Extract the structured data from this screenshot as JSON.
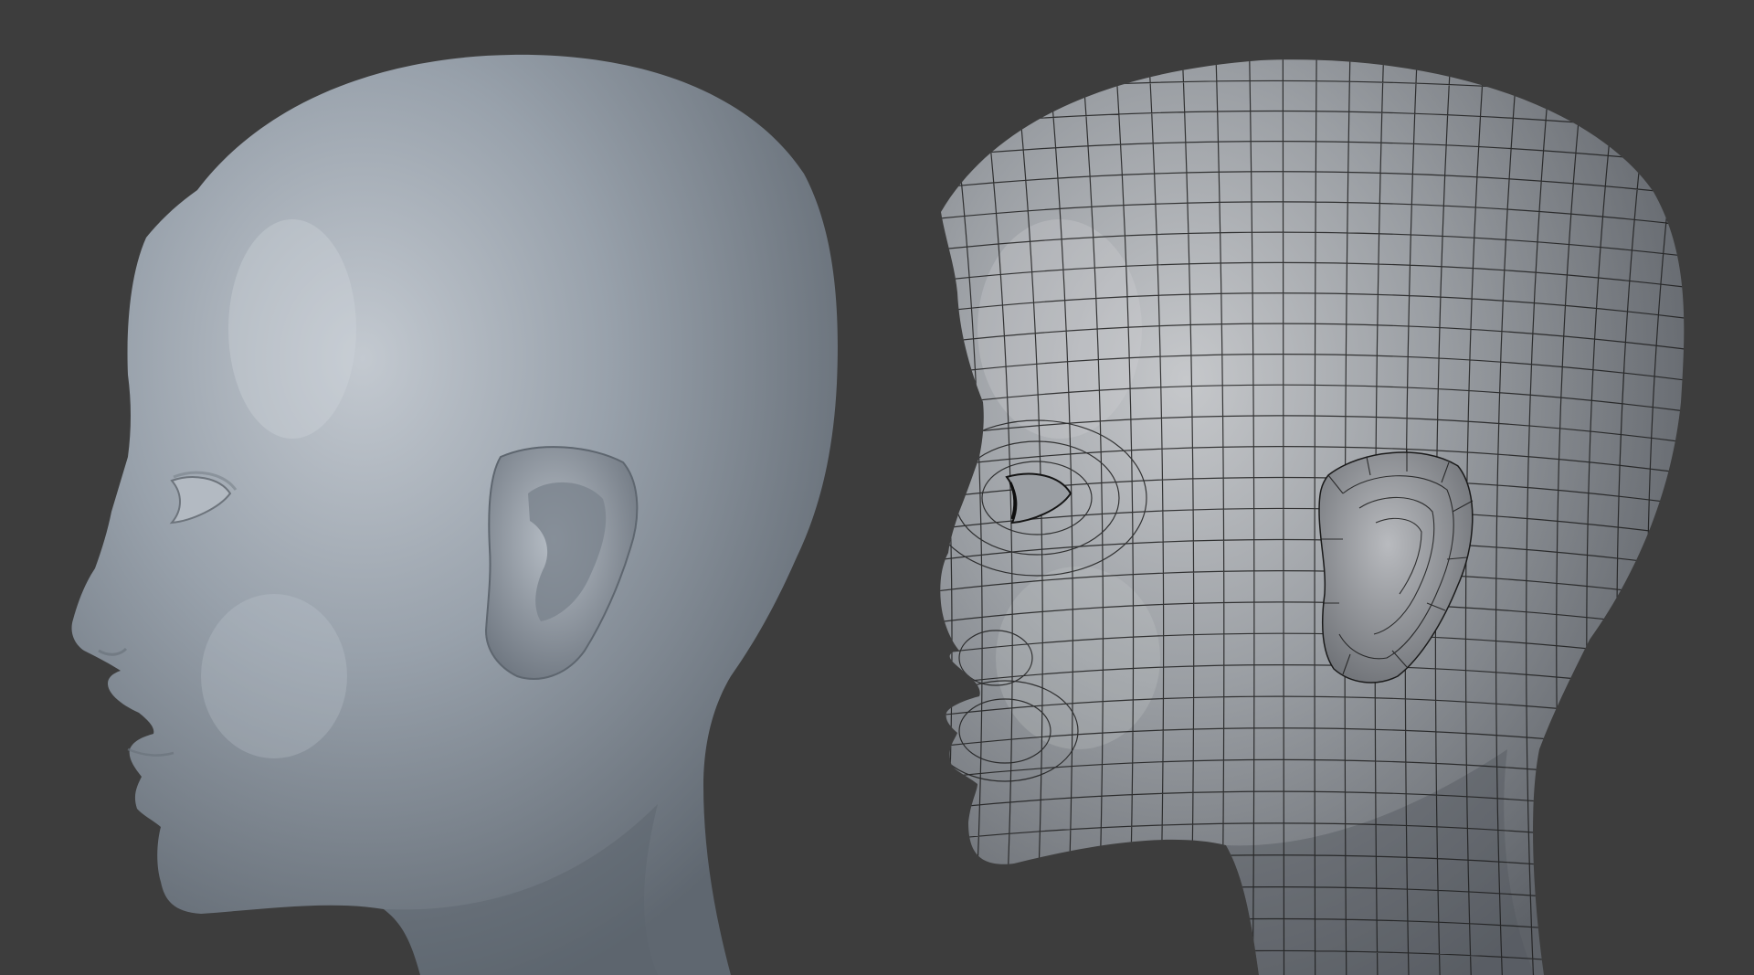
{
  "scene": {
    "background_color": "#3d3d3d",
    "models": [
      {
        "name": "head-smooth-shaded",
        "shading": "smooth",
        "wireframe": false,
        "base_color": "#8e98a3"
      },
      {
        "name": "head-wireframe-overlay",
        "shading": "smooth",
        "wireframe": true,
        "base_color": "#8a8f96",
        "wire_color": "#1c1c1c"
      }
    ]
  }
}
